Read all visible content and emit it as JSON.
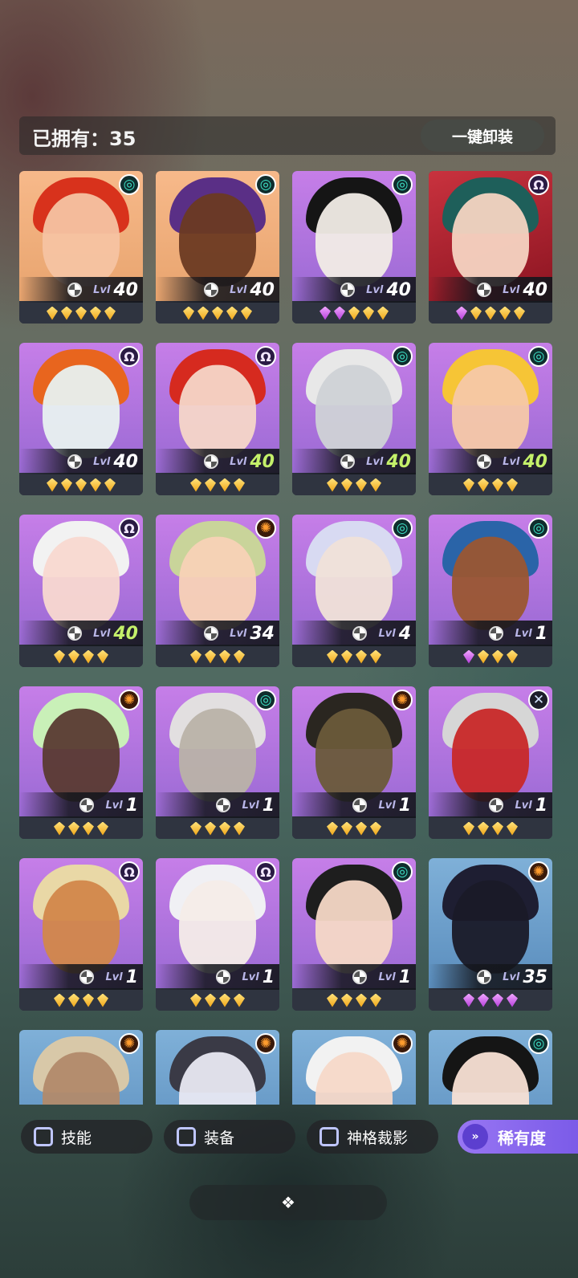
{
  "header": {
    "owned_label": "已拥有：35",
    "unequip_label": "一键卸装"
  },
  "heroes": [
    {
      "elem": "spiral",
      "elem_glyph": "◎",
      "level": "40",
      "gems": [
        "gold",
        "gold",
        "gold",
        "gold",
        "gold"
      ],
      "bg": "bg-orange",
      "hair": "#d8321c",
      "skin": "#f6c3a2"
    },
    {
      "elem": "spiral",
      "elem_glyph": "◎",
      "level": "40",
      "gems": [
        "gold",
        "gold",
        "gold",
        "gold",
        "gold"
      ],
      "bg": "bg-orange",
      "hair": "#5a2f86",
      "skin": "#6b3a22"
    },
    {
      "elem": "spiral",
      "elem_glyph": "◎",
      "level": "40",
      "gems": [
        "purple",
        "purple",
        "gold",
        "gold",
        "gold"
      ],
      "bg": "",
      "hair": "#151515",
      "skin": "#f1ece6"
    },
    {
      "elem": "omega",
      "elem_glyph": "Ω",
      "level": "40",
      "gems": [
        "purple",
        "gold",
        "gold",
        "gold",
        "gold"
      ],
      "bg": "bg-red",
      "hair": "#1e5f5a",
      "skin": "#f6d4c2"
    },
    {
      "elem": "omega",
      "elem_glyph": "Ω",
      "level": "40",
      "gems": [
        "gold",
        "gold",
        "gold",
        "gold",
        "gold"
      ],
      "bg": "",
      "hair": "#e8651e",
      "skin": "#e8f1f0"
    },
    {
      "elem": "omega",
      "elem_glyph": "Ω",
      "level": "40",
      "gems": [
        "gold",
        "gold",
        "gold",
        "gold"
      ],
      "bg": "",
      "hair": "#d62a1f",
      "skin": "#f6d6c8"
    },
    {
      "elem": "spiral",
      "elem_glyph": "◎",
      "level": "40",
      "gems": [
        "gold",
        "gold",
        "gold",
        "gold"
      ],
      "bg": "",
      "hair": "#e8e8e8",
      "skin": "#cfd2d6"
    },
    {
      "elem": "spiral",
      "elem_glyph": "◎",
      "level": "40",
      "gems": [
        "gold",
        "gold",
        "gold",
        "gold"
      ],
      "bg": "",
      "hair": "#f6c536",
      "skin": "#f6c8a8"
    },
    {
      "elem": "omega",
      "elem_glyph": "Ω",
      "level": "40",
      "gems": [
        "gold",
        "gold",
        "gold",
        "gold"
      ],
      "bg": "",
      "hair": "#f2f2f2",
      "skin": "#f8d8d0"
    },
    {
      "elem": "sun",
      "elem_glyph": "✺",
      "level": "34",
      "gems": [
        "gold",
        "gold",
        "gold",
        "gold"
      ],
      "bg": "",
      "hair": "#c9d49a",
      "skin": "#f8d2b6"
    },
    {
      "elem": "spiral",
      "elem_glyph": "◎",
      "level": "4",
      "gems": [
        "gold",
        "gold",
        "gold",
        "gold"
      ],
      "bg": "",
      "hair": "#d8daf2",
      "skin": "#f0e2d8"
    },
    {
      "elem": "spiral",
      "elem_glyph": "◎",
      "level": "1",
      "gems": [
        "purple",
        "gold",
        "gold",
        "gold"
      ],
      "bg": "",
      "hair": "#2a64a8",
      "skin": "#9a5632"
    },
    {
      "elem": "sun",
      "elem_glyph": "✺",
      "level": "1",
      "gems": [
        "gold",
        "gold",
        "gold",
        "gold"
      ],
      "bg": "",
      "hair": "#c9f0b8",
      "skin": "#5a3a32"
    },
    {
      "elem": "spiral",
      "elem_glyph": "◎",
      "level": "1",
      "gems": [
        "gold",
        "gold",
        "gold",
        "gold"
      ],
      "bg": "",
      "hair": "#e2dfe0",
      "skin": "#b9b2a8"
    },
    {
      "elem": "sun",
      "elem_glyph": "✺",
      "level": "1",
      "gems": [
        "gold",
        "gold",
        "gold",
        "gold"
      ],
      "bg": "",
      "hair": "#2a2620",
      "skin": "#6a5a3a"
    },
    {
      "elem": "cross",
      "elem_glyph": "✕",
      "level": "1",
      "gems": [
        "gold",
        "gold",
        "gold",
        "gold"
      ],
      "bg": "",
      "hair": "#d6d6d6",
      "skin": "#c82828"
    },
    {
      "elem": "omega",
      "elem_glyph": "Ω",
      "level": "1",
      "gems": [
        "gold",
        "gold",
        "gold",
        "gold"
      ],
      "bg": "",
      "hair": "#e9d8a6",
      "skin": "#d2874a"
    },
    {
      "elem": "omega",
      "elem_glyph": "Ω",
      "level": "1",
      "gems": [
        "gold",
        "gold",
        "gold",
        "gold"
      ],
      "bg": "",
      "hair": "#f0f0f4",
      "skin": "#f4ece8"
    },
    {
      "elem": "spiral",
      "elem_glyph": "◎",
      "level": "1",
      "gems": [
        "gold",
        "gold",
        "gold",
        "gold"
      ],
      "bg": "",
      "hair": "#1e1e1e",
      "skin": "#f6d8c6"
    },
    {
      "elem": "sun",
      "elem_glyph": "✺",
      "level": "35",
      "gems": [
        "purple",
        "purple",
        "purple",
        "purple"
      ],
      "bg": "bg-blue",
      "hair": "#1e1e32",
      "skin": "#1a1a28"
    },
    {
      "elem": "sun",
      "elem_glyph": "✺",
      "level": "",
      "gems": [],
      "bg": "bg-blue",
      "hair": "#d8c8a8",
      "skin": "#b28a6a"
    },
    {
      "elem": "sun",
      "elem_glyph": "✺",
      "level": "",
      "gems": [],
      "bg": "bg-blue",
      "hair": "#3a3a46",
      "skin": "#e8e8f2"
    },
    {
      "elem": "sun",
      "elem_glyph": "✺",
      "level": "",
      "gems": [],
      "bg": "bg-blue",
      "hair": "#f2f2f2",
      "skin": "#f6d8c8"
    },
    {
      "elem": "spiral",
      "elem_glyph": "◎",
      "level": "",
      "gems": [],
      "bg": "bg-blue",
      "hair": "#151515",
      "skin": "#f8e0d4"
    }
  ],
  "lvl_prefix": "Lvl",
  "filters": {
    "skill": "技能",
    "equip": "装备",
    "divine": "神格裁影",
    "rarity": "稀有度",
    "rarity_icon": "»"
  },
  "handle_icon": "❖"
}
